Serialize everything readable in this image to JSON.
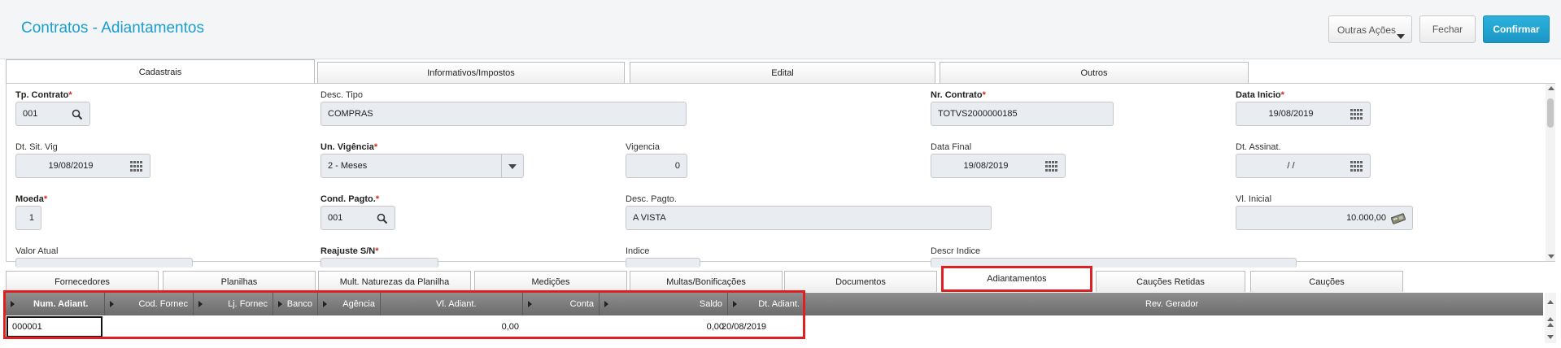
{
  "header": {
    "title": "Contratos - Adiantamentos",
    "more_actions": "Outras Ações",
    "close": "Fechar",
    "confirm": "Confirmar"
  },
  "tabs": [
    "Cadastrais",
    "Informativos/Impostos",
    "Edital",
    "Outros"
  ],
  "fields": {
    "tp_contrato": {
      "label": "Tp. Contrato",
      "value": "001"
    },
    "desc_tipo": {
      "label": "Desc. Tipo",
      "value": "COMPRAS"
    },
    "nr_contrato": {
      "label": "Nr. Contrato",
      "value": "TOTVS2000000185"
    },
    "data_inicio": {
      "label": "Data Inicio",
      "value": "19/08/2019"
    },
    "dt_sit_vig": {
      "label": "Dt. Sit. Vig",
      "value": "19/08/2019"
    },
    "un_vigencia": {
      "label": "Un. Vigência",
      "value": "2 - Meses"
    },
    "vigencia": {
      "label": "Vigencia",
      "value": "0"
    },
    "data_final": {
      "label": "Data Final",
      "value": "19/08/2019"
    },
    "dt_assinat": {
      "label": "Dt. Assinat.",
      "value": "/ /"
    },
    "moeda": {
      "label": "Moeda",
      "value": "1"
    },
    "cond_pagto": {
      "label": "Cond. Pagto.",
      "value": "001"
    },
    "desc_pagto": {
      "label": "Desc. Pagto.",
      "value": "A VISTA"
    },
    "vl_inicial": {
      "label": "Vl. Inicial",
      "value": "10.000,00"
    },
    "valor_atual": {
      "label": "Valor Atual"
    },
    "reajuste": {
      "label": "Reajuste S/N"
    },
    "indice": {
      "label": "Indice"
    },
    "descr_indice": {
      "label": "Descr Indice"
    }
  },
  "bottom_tabs": [
    "Fornecedores",
    "Planilhas",
    "Mult. Naturezas da Planilha",
    "Medições",
    "Multas/Bonificações",
    "Documentos",
    "Adiantamentos",
    "Cauções Retidas",
    "Cauções"
  ],
  "grid": {
    "columns": [
      "Num. Adiant.",
      "Cod. Fornec",
      "Lj. Fornec",
      "Banco",
      "Agência",
      "Vl. Adiant.",
      "Conta",
      "Saldo",
      "Dt. Adiant.",
      "Rev. Gerador"
    ],
    "row": {
      "num_adiant": "000001",
      "vl_adiant": "0,00",
      "saldo": "0,00",
      "dt_adiant": "20/08/2019"
    }
  },
  "colors": {
    "accent": "#1a9ed0",
    "confirm": "#1b96c4",
    "required": "#d9231c",
    "highlight": "#e02020"
  }
}
